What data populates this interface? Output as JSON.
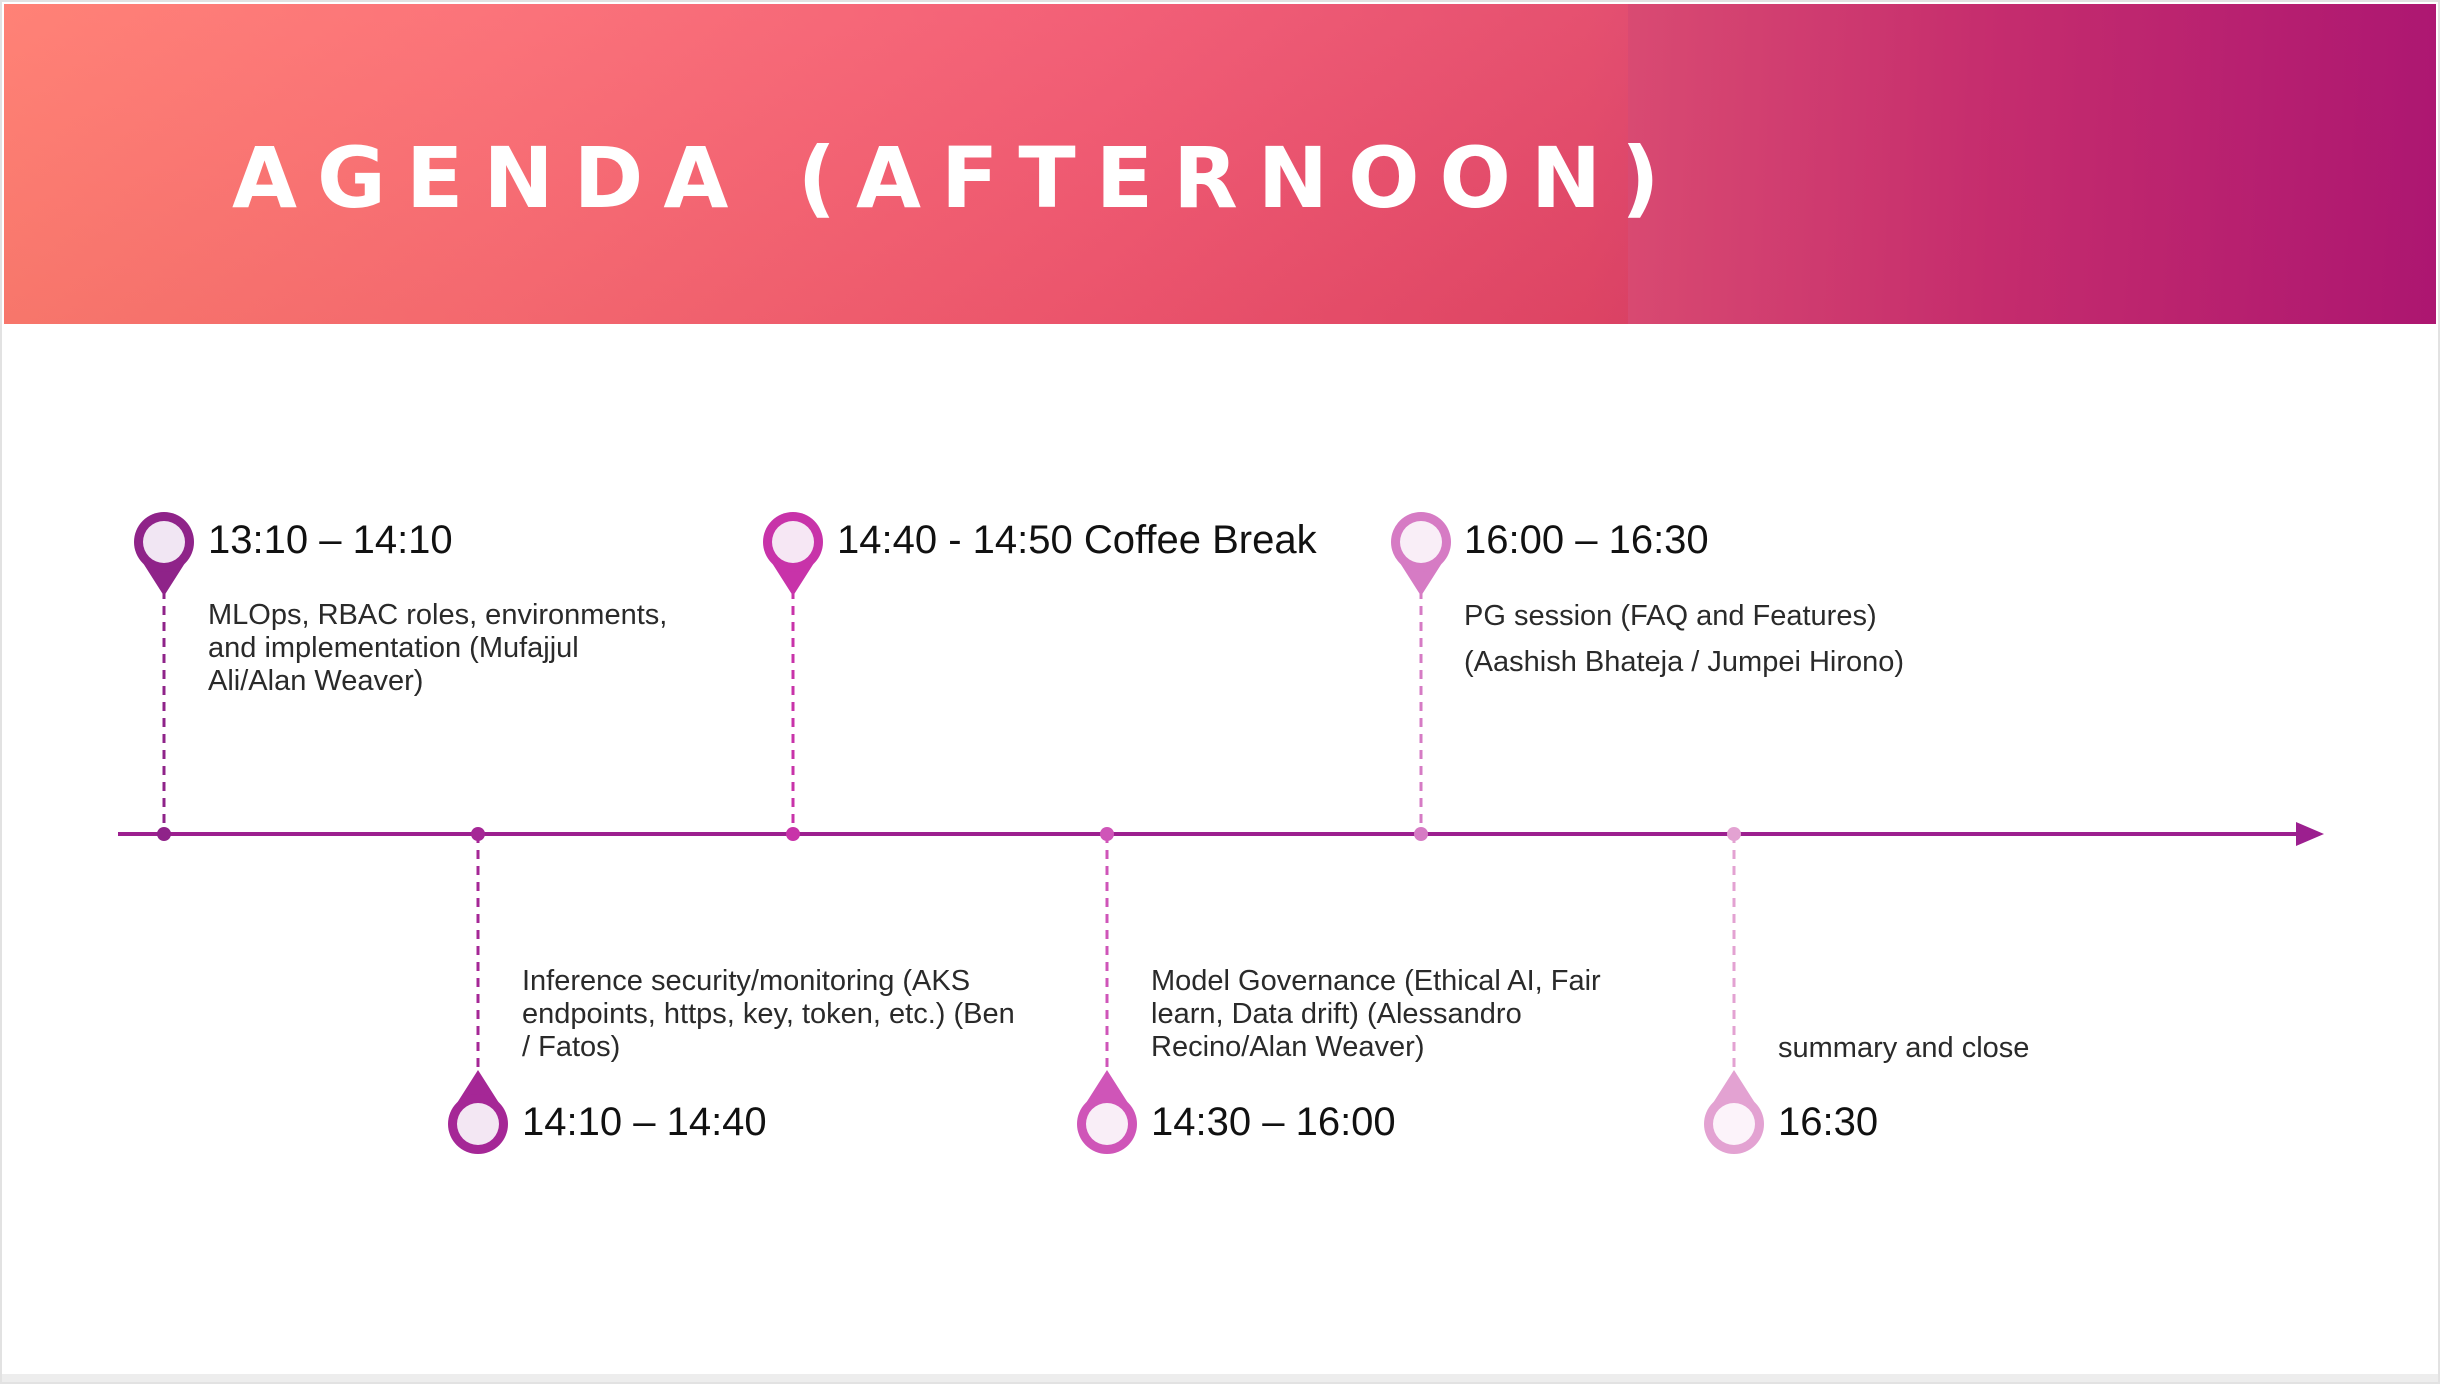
{
  "title": "AGENDA (AFTERNOON)",
  "colors": {
    "axis": "#9c1f8f",
    "slot1": "#8f2389",
    "slot2": "#a52796",
    "slot3": "#c833a9",
    "slot4": "#cf55b8",
    "slot5": "#d67bc4",
    "slot6": "#e3a2d2"
  },
  "slots": [
    {
      "time": "13:10 – 14:10",
      "description": [
        "MLOps, RBAC roles, environments,",
        "and implementation (Mufajjul",
        "Ali/Alan Weaver)"
      ]
    },
    {
      "time": "14:10 – 14:40",
      "description": [
        "Inference security/monitoring (AKS",
        "endpoints, https, key, token, etc.) (Ben",
        "/ Fatos)"
      ]
    },
    {
      "time": "14:40 - 14:50  Coffee Break",
      "description": []
    },
    {
      "time": "14:30 – 16:00",
      "description": [
        "Model Governance (Ethical AI, Fair",
        "learn, Data drift) (Alessandro",
        "Recino/Alan Weaver)"
      ]
    },
    {
      "time": "16:00 – 16:30",
      "description": [
        "PG session (FAQ and Features)",
        "(Aashish Bhateja / Jumpei Hirono)"
      ]
    },
    {
      "time": "16:30",
      "description": [
        "summary and close"
      ]
    }
  ]
}
